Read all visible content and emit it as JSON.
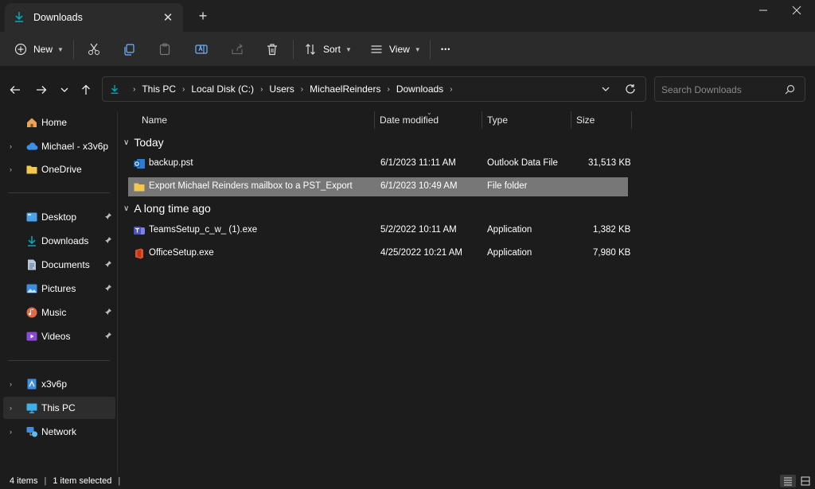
{
  "tab": {
    "title": "Downloads",
    "close": "✕",
    "new_tab": "+"
  },
  "window_controls": {
    "minimize": "—",
    "maximize": "☐",
    "close": "✕"
  },
  "toolbar": {
    "new_label": "New",
    "sort_label": "Sort",
    "view_label": "View",
    "more_label": "•••"
  },
  "address": {
    "breadcrumbs": [
      "This PC",
      "Local Disk (C:)",
      "Users",
      "MichaelReinders",
      "Downloads"
    ],
    "separator": "›"
  },
  "search": {
    "placeholder": "Search Downloads"
  },
  "sidebar": {
    "items": [
      {
        "label": "Home",
        "icon": "home-icon"
      },
      {
        "label": "Michael - x3v6p",
        "icon": "cloud-icon",
        "expandable": true
      },
      {
        "label": "OneDrive",
        "icon": "folder-icon",
        "expandable": true
      },
      {
        "label": "Desktop",
        "icon": "desktop-icon",
        "pinned": true
      },
      {
        "label": "Downloads",
        "icon": "download-icon",
        "pinned": true
      },
      {
        "label": "Documents",
        "icon": "documents-icon",
        "pinned": true
      },
      {
        "label": "Pictures",
        "icon": "pictures-icon",
        "pinned": true
      },
      {
        "label": "Music",
        "icon": "music-icon",
        "pinned": true
      },
      {
        "label": "Videos",
        "icon": "videos-icon",
        "pinned": true
      },
      {
        "label": "x3v6p",
        "icon": "drive-icon",
        "expandable": true
      },
      {
        "label": "This PC",
        "icon": "this-pc-icon",
        "expandable": true,
        "selected": true
      },
      {
        "label": "Network",
        "icon": "network-icon",
        "expandable": true
      }
    ],
    "pin_glyph": "📌",
    "expand_glyph": "›"
  },
  "columns": {
    "name": "Name",
    "date": "Date modified",
    "type": "Type",
    "size": "Size"
  },
  "groups": {
    "today": "Today",
    "long_ago": "A long time ago"
  },
  "files": [
    {
      "name": "backup.pst",
      "date": "6/1/2023 11:11 AM",
      "type": "Outlook Data File",
      "size": "31,513 KB",
      "icon": "outlook-icon"
    },
    {
      "name": "Export Michael Reinders mailbox to a PST_Export",
      "date": "6/1/2023 10:49 AM",
      "type": "File folder",
      "size": "",
      "icon": "folder-icon",
      "selected": true
    },
    {
      "name": "TeamsSetup_c_w_ (1).exe",
      "date": "5/2/2022 10:11 AM",
      "type": "Application",
      "size": "1,382 KB",
      "icon": "teams-icon"
    },
    {
      "name": "OfficeSetup.exe",
      "date": "4/25/2022 10:21 AM",
      "type": "Application",
      "size": "7,980 KB",
      "icon": "office-icon"
    }
  ],
  "status": {
    "count": "4 items",
    "selected": "1 item selected",
    "sep": "|"
  },
  "colors": {
    "accent": "#0aa3b0",
    "folder": "#f2c94c",
    "selection": "#777777"
  }
}
